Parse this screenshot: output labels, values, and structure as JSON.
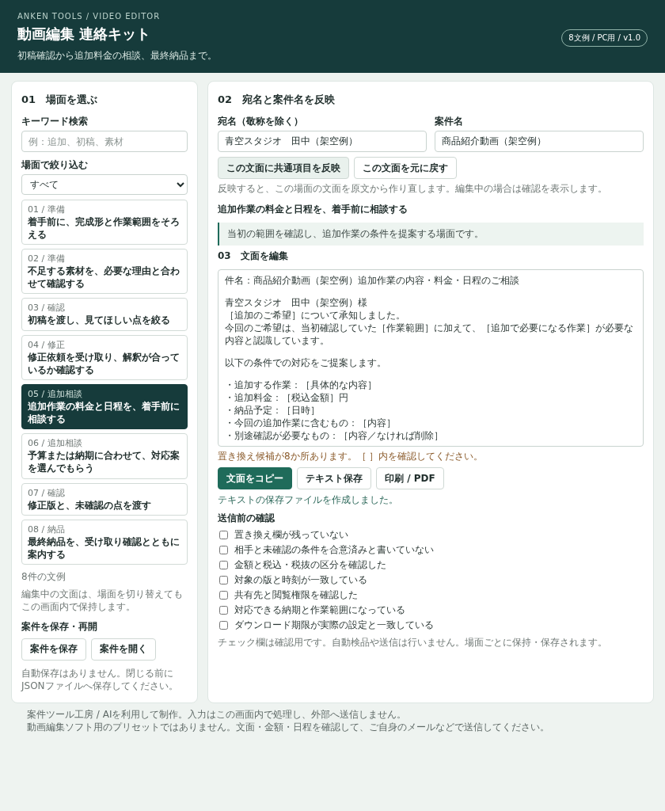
{
  "header": {
    "eyebrow": "ANKEN TOOLS / VIDEO EDITOR",
    "title": "動画編集 連絡キット",
    "subtitle": "初稿確認から追加料金の相談、最終納品まで。",
    "badge": "8文例 / PC用 / v1.0"
  },
  "sidebar": {
    "heading": "01　場面を選ぶ",
    "search_label": "キーワード検索",
    "search_placeholder": "例：追加、初稿、素材",
    "filter_label": "場面で絞り込む",
    "filter_value": "すべて",
    "scenes": [
      {
        "tag": "01 / 準備",
        "title": "着手前に、完成形と作業範囲をそろえる",
        "selected": false
      },
      {
        "tag": "02 / 準備",
        "title": "不足する素材を、必要な理由と合わせて確認する",
        "selected": false
      },
      {
        "tag": "03 / 確認",
        "title": "初稿を渡し、見てほしい点を絞る",
        "selected": false
      },
      {
        "tag": "04 / 修正",
        "title": "修正依頼を受け取り、解釈が合っているか確認する",
        "selected": false
      },
      {
        "tag": "05 / 追加相談",
        "title": "追加作業の料金と日程を、着手前に相談する",
        "selected": true
      },
      {
        "tag": "06 / 追加相談",
        "title": "予算または納期に合わせて、対応案を選んでもらう",
        "selected": false
      },
      {
        "tag": "07 / 確認",
        "title": "修正版と、未確認の点を渡す",
        "selected": false
      },
      {
        "tag": "08 / 納品",
        "title": "最終納品を、受け取り確認とともに案内する",
        "selected": false
      }
    ],
    "count": "8件の文例",
    "note": "編集中の文面は、場面を切り替えてもこの画面内で保持します。",
    "save_heading": "案件を保存・再開",
    "buttons": [
      "案件を保存",
      "案件を開く"
    ],
    "save_note": "自動保存はありません。閉じる前にJSONファイルへ保存してください。"
  },
  "main": {
    "heading": "02　宛名と案件名を反映",
    "fields": [
      {
        "label": "宛名（敬称を除く）",
        "value": "青空スタジオ　田中（架空例）"
      },
      {
        "label": "案件名",
        "value": "商品紹介動画（架空例）"
      }
    ],
    "apply_buttons": [
      {
        "label": "この文面に共通項目を反映",
        "kind": "tinted"
      },
      {
        "label": "この文面を元に戻す",
        "kind": "plain"
      }
    ],
    "apply_note": "反映すると、この場面の文面を原文から作り直します。編集中の場合は確認を表示します。",
    "scene_title": "追加作業の料金と日程を、着手前に相談する",
    "scene_note": "当初の範囲を確認し、追加作業の条件を提案する場面です。",
    "editor_heading": "03　文面を編集",
    "body": [
      [
        "件名：商品紹介動画（架空例）追加作業の内容・料金・日程のご相談"
      ],
      [
        "青空スタジオ　田中（架空例）様",
        "［追加のご希望］について承知しました。",
        "今回のご希望は、当初確認していた［作業範囲］に加えて、［追加で必要になる作業］が必要な内容と認識しています。"
      ],
      [
        "以下の条件での対応をご提案します。"
      ],
      [
        "・追加する作業：［具体的な内容］",
        "・追加料金：［税込金額］円",
        "・納品予定：［日時］",
        "・今回の追加作業に含むもの：［内容］",
        "・別途確認が必要なもの：［内容／なければ削除］"
      ]
    ],
    "warning": "置き換え候補が8か所あります。［ ］内を確認してください。",
    "actions": [
      {
        "label": "文面をコピー",
        "kind": "primary"
      },
      {
        "label": "テキスト保存",
        "kind": "plain"
      },
      {
        "label": "印刷 / PDF",
        "kind": "plain"
      }
    ],
    "status": "テキストの保存ファイルを作成しました。",
    "checklist_heading": "送信前の確認",
    "checklist": [
      {
        "label": "置き換え欄が残っていない",
        "checked": false
      },
      {
        "label": "相手と未確認の条件を合意済みと書いていない",
        "checked": false
      },
      {
        "label": "金額と税込・税抜の区分を確認した",
        "checked": false
      },
      {
        "label": "対象の版と時刻が一致している",
        "checked": false
      },
      {
        "label": "共有先と閲覧権限を確認した",
        "checked": false
      },
      {
        "label": "対応できる納期と作業範囲になっている",
        "checked": false
      },
      {
        "label": "ダウンロード期限が実際の設定と一致している",
        "checked": false
      }
    ],
    "checklist_note": "チェック欄は確認用です。自動検品や送信は行いません。場面ごとに保持・保存されます。"
  },
  "footer": [
    "案件ツール工房 / AIを利用して制作。入力はこの画面内で処理し、外部へ送信しません。",
    "動画編集ソフト用のプリセットではありません。文面・金額・日程を確認して、ご自身のメールなどで送信してください。"
  ]
}
